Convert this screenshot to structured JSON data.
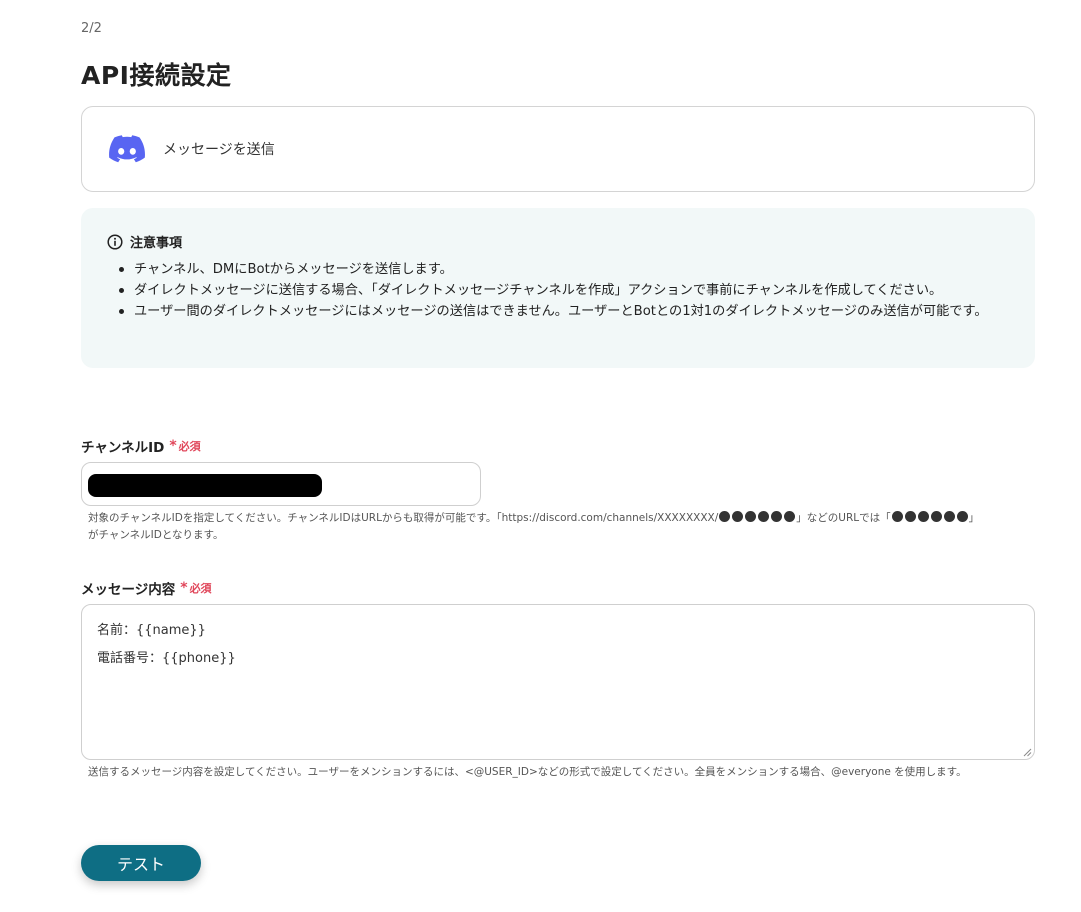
{
  "header": {
    "step": "2/2",
    "title": "API接続設定"
  },
  "action_card": {
    "icon": "discord-icon",
    "label": "メッセージを送信",
    "icon_color": "#5865F2"
  },
  "notice": {
    "heading": "注意事項",
    "items": [
      "チャンネル、DMにBotからメッセージを送信します。",
      "ダイレクトメッセージに送信する場合、「ダイレクトメッセージチャンネルを作成」アクションで事前にチャンネルを作成してください。",
      "ユーザー間のダイレクトメッセージにはメッセージの送信はできません。ユーザーとBotとの1対1のダイレクトメッセージのみ送信が可能です。"
    ]
  },
  "channel_field": {
    "label": "チャンネルID",
    "required_star": "*",
    "required_text": "必須",
    "help_part1": "対象のチャンネルIDを指定してください。チャンネルIDはURLからも取得が可能です。「https://discord.com/channels/XXXXXXXX/",
    "help_part2": "」などのURLでは「",
    "help_part3": "」",
    "help_line2": "がチャンネルIDとなります。"
  },
  "message_field": {
    "label": "メッセージ内容",
    "required_star": "*",
    "required_text": "必須",
    "lines": [
      "名前：{{name}}",
      "電話番号：{{phone}}"
    ],
    "help": "送信するメッセージ内容を設定してください。ユーザーをメンションするには、<@USER_ID>などの形式で設定してください。全員をメンションする場合、@everyone を使用します。"
  },
  "test_button": {
    "label": "テスト",
    "color": "#0e6e84"
  },
  "colors": {
    "required": "#e0465a",
    "notice_bg": "#f2f8f8"
  }
}
